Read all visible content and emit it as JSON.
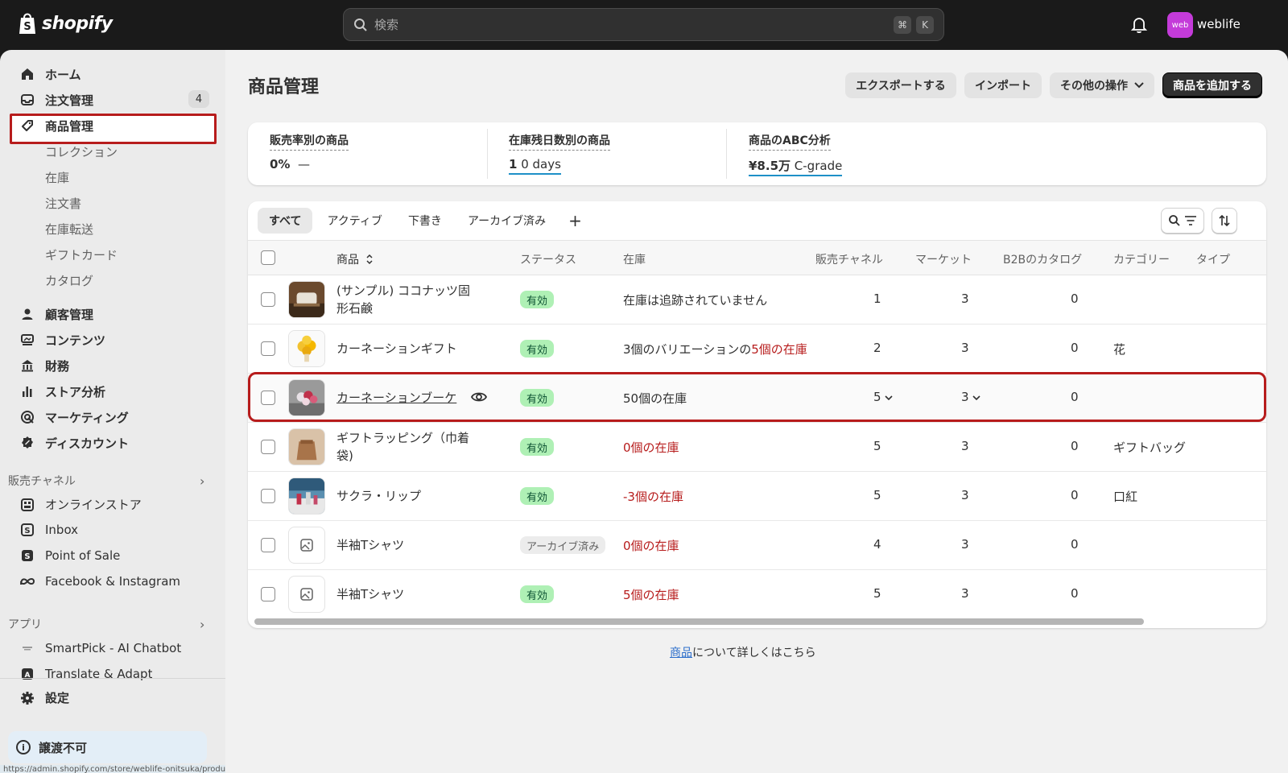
{
  "topbar": {
    "logo_text": "shopify",
    "search_placeholder": "検索",
    "shortcut_keys": [
      "⌘",
      "K"
    ],
    "avatar_text": "web",
    "store_name": "weblife"
  },
  "sidebar": {
    "nav": [
      {
        "label": "ホーム",
        "icon": "home-icon"
      },
      {
        "label": "注文管理",
        "icon": "inbox-icon",
        "count": "4"
      },
      {
        "label": "商品管理",
        "icon": "tag-icon"
      }
    ],
    "sub_items": [
      "コレクション",
      "在庫",
      "注文書",
      "在庫転送",
      "ギフトカード",
      "カタログ"
    ],
    "nav2": [
      {
        "label": "顧客管理",
        "icon": "person-icon"
      },
      {
        "label": "コンテンツ",
        "icon": "content-icon"
      },
      {
        "label": "財務",
        "icon": "bank-icon"
      },
      {
        "label": "ストア分析",
        "icon": "chart-icon"
      },
      {
        "label": "マーケティング",
        "icon": "target-icon"
      },
      {
        "label": "ディスカウント",
        "icon": "discount-icon"
      }
    ],
    "sales_channels_label": "販売チャネル",
    "channels": [
      {
        "label": "オンラインストア",
        "icon": "store-icon"
      },
      {
        "label": "Inbox",
        "icon": "inbox-app-icon"
      },
      {
        "label": "Point of Sale",
        "icon": "pos-icon"
      },
      {
        "label": "Facebook & Instagram",
        "icon": "meta-icon"
      }
    ],
    "apps_label": "アプリ",
    "apps": [
      {
        "label": "SmartPick - AI Chatbot",
        "icon": "smartpick-icon"
      },
      {
        "label": "Translate & Adapt",
        "icon": "translate-icon"
      }
    ],
    "settings_label": "設定",
    "notice_text": "譲渡不可",
    "status_url": "https://admin.shopify.com/store/weblife-onitsuka/products/9234971955486"
  },
  "main": {
    "title": "商品管理",
    "buttons": {
      "export": "エクスポートする",
      "import": "インポート",
      "more": "その他の操作",
      "add": "商品を追加する"
    },
    "stats": [
      {
        "label": "販売率別の商品",
        "value_bold": "0%",
        "value_rest": "—"
      },
      {
        "label": "在庫残日数別の商品",
        "value_bold": "1",
        "value_rest": "0 days"
      },
      {
        "label": "商品のABC分析",
        "value_bold": "¥8.5万",
        "value_rest": "C-grade"
      }
    ],
    "tabs": [
      "すべて",
      "アクティブ",
      "下書き",
      "アーカイブ済み",
      "+"
    ],
    "columns": [
      "商品",
      "ステータス",
      "在庫",
      "販売チャネル",
      "マーケット",
      "B2Bのカタログ",
      "カテゴリー",
      "タイプ"
    ],
    "rows": [
      {
        "name": "(サンプル) ココナッツ固形石鹸",
        "status": "有効",
        "inventory_plain": "在庫は追跡されていません",
        "inventory_red": "",
        "channels": "1",
        "markets": "3",
        "b2b": "0",
        "category": ""
      },
      {
        "name": "カーネーションギフト",
        "status": "有効",
        "inventory_plain": "3個のバリエーションの",
        "inventory_red": "5個の在庫",
        "channels": "2",
        "markets": "3",
        "b2b": "0",
        "category": "花"
      },
      {
        "name": "カーネーションブーケ",
        "status": "有効",
        "inventory_plain": "50個の在庫",
        "inventory_red": "",
        "channels": "5",
        "markets": "3",
        "b2b": "0",
        "category": ""
      },
      {
        "name": "ギフトラッピング（巾着袋)",
        "status": "有効",
        "inventory_plain": "",
        "inventory_red": "0個の在庫",
        "channels": "5",
        "markets": "3",
        "b2b": "0",
        "category": "ギフトバッグ"
      },
      {
        "name": "サクラ・リップ",
        "status": "有効",
        "inventory_plain": "",
        "inventory_red": "-3個の在庫",
        "channels": "5",
        "markets": "3",
        "b2b": "0",
        "category": "口紅"
      },
      {
        "name": "半袖Tシャツ",
        "status": "アーカイブ済み",
        "inventory_plain": "",
        "inventory_red": "0個の在庫",
        "channels": "4",
        "markets": "3",
        "b2b": "0",
        "category": ""
      },
      {
        "name": "半袖Tシャツ",
        "status": "有効",
        "inventory_plain": "",
        "inventory_red": "5個の在庫",
        "channels": "5",
        "markets": "3",
        "b2b": "0",
        "category": ""
      }
    ],
    "footer_link": "商品",
    "footer_rest": "について詳しくはこちら"
  },
  "colors": {
    "topbar": "#1a1a1a",
    "status_active_bg": "#aff0b5",
    "status_active_text": "#0c5132",
    "alert_red": "#b71c1c",
    "highlight_border": "#b71c1c",
    "link_blue": "#2c6ecb"
  }
}
